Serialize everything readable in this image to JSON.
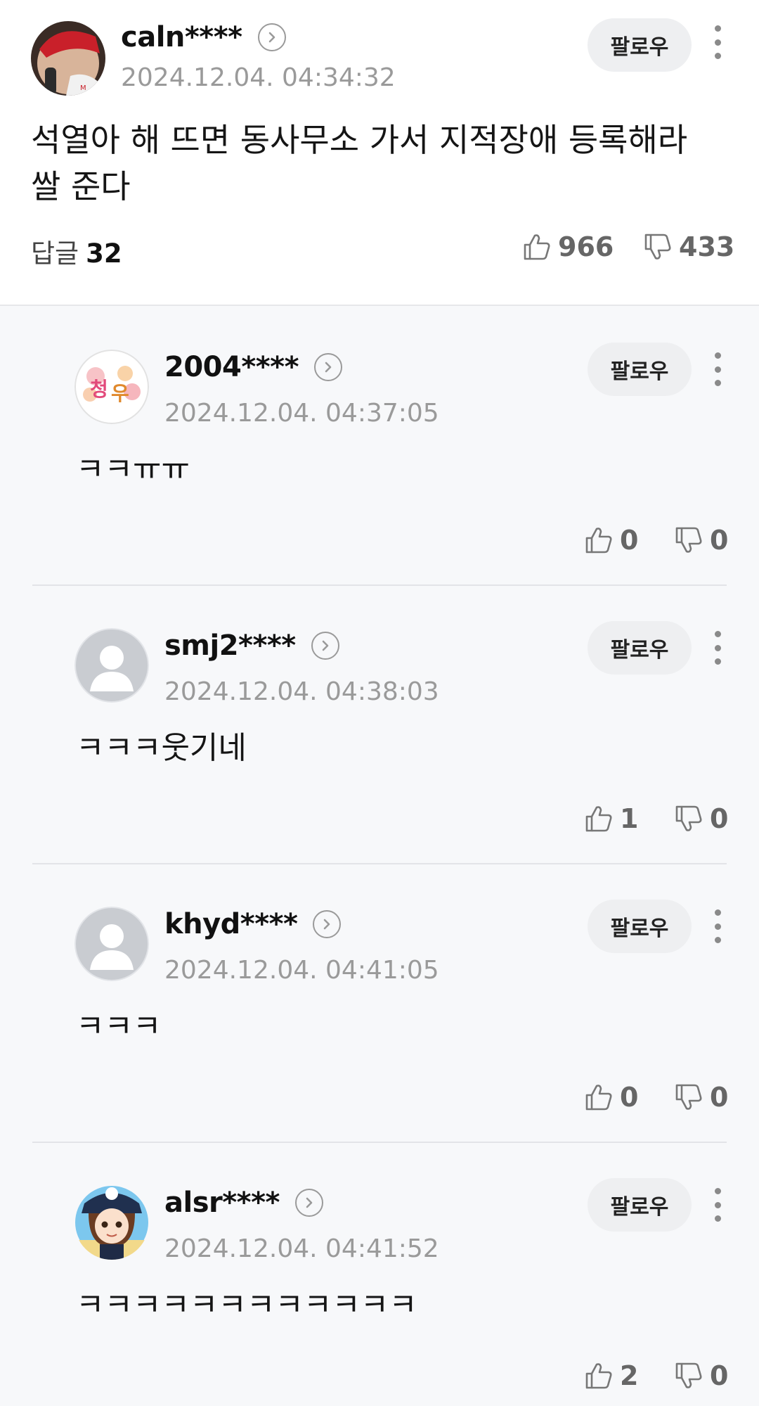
{
  "main_comment": {
    "nickname": "caln****",
    "timestamp": "2024.12.04. 04:34:32",
    "follow_label": "팔로우",
    "text": "석열아 해 뜨면 동사무소 가서 지적장애 등록해라\n쌀 준다",
    "reply_label": "답글",
    "reply_count": "32",
    "likes": "966",
    "dislikes": "433"
  },
  "replies": [
    {
      "nickname": "2004****",
      "timestamp": "2024.12.04. 04:37:05",
      "follow_label": "팔로우",
      "text": "ㅋㅋㅠㅠ",
      "likes": "0",
      "dislikes": "0",
      "avatar": "sticker-avatar"
    },
    {
      "nickname": "smj2****",
      "timestamp": "2024.12.04. 04:38:03",
      "follow_label": "팔로우",
      "text": "ㅋㅋㅋ웃기네",
      "likes": "1",
      "dislikes": "0",
      "avatar": "default-avatar"
    },
    {
      "nickname": "khyd****",
      "timestamp": "2024.12.04. 04:41:05",
      "follow_label": "팔로우",
      "text": "ㅋㅋㅋ",
      "likes": "0",
      "dislikes": "0",
      "avatar": "default-avatar"
    },
    {
      "nickname": "alsr****",
      "timestamp": "2024.12.04. 04:41:52",
      "follow_label": "팔로우",
      "text": "ㅋㅋㅋㅋㅋㅋㅋㅋㅋㅋㅋㅋ",
      "likes": "2",
      "dislikes": "0",
      "avatar": "character-avatar"
    }
  ],
  "icons": {
    "thumbs_up": "thumbs-up-icon",
    "thumbs_down": "thumbs-down-icon",
    "profile_arrow": "chevron-right-icon",
    "more": "more-vertical-icon"
  },
  "colors": {
    "background": "#f7f8fa",
    "main_background": "#ffffff",
    "muted_text": "#9a9a9a",
    "follow_button_bg": "#eeeff1"
  }
}
